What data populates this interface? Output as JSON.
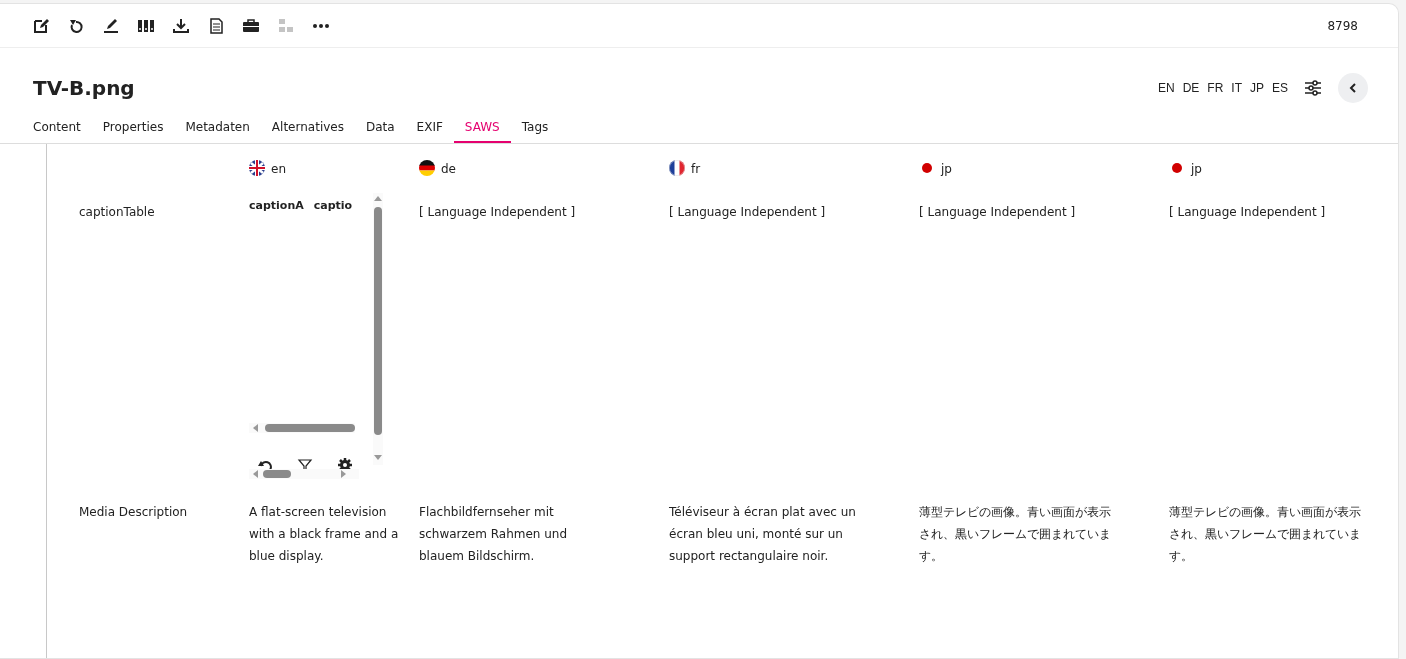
{
  "toolbar": {
    "tools": [
      {
        "kind": "edit",
        "disabled": false
      },
      {
        "kind": "undo",
        "disabled": false
      },
      {
        "kind": "sign",
        "disabled": false
      },
      {
        "kind": "binders",
        "disabled": false
      },
      {
        "kind": "download",
        "disabled": false
      },
      {
        "kind": "document",
        "disabled": false
      },
      {
        "kind": "briefcase",
        "disabled": false
      },
      {
        "kind": "hierarchy",
        "disabled": true
      },
      {
        "kind": "more",
        "disabled": false
      }
    ],
    "counter": "8798"
  },
  "header": {
    "title": "TV-B.png",
    "languages": [
      "EN",
      "DE",
      "FR",
      "IT",
      "JP",
      "ES"
    ]
  },
  "tabs": [
    {
      "label": "Content",
      "selected": false
    },
    {
      "label": "Properties",
      "selected": false
    },
    {
      "label": "Metadaten",
      "selected": false
    },
    {
      "label": "Alternatives",
      "selected": false
    },
    {
      "label": "Data",
      "selected": false
    },
    {
      "label": "EXIF",
      "selected": false
    },
    {
      "label": "SAWS",
      "selected": true
    },
    {
      "label": "Tags",
      "selected": false
    }
  ],
  "table": {
    "columns": [
      {
        "label": "en",
        "kind": "uk"
      },
      {
        "label": "de",
        "kind": "de"
      },
      {
        "label": "fr",
        "kind": "fr"
      },
      {
        "label": "jp",
        "kind": "jp"
      },
      {
        "label": "jp",
        "kind": "jp"
      }
    ],
    "rows": [
      {
        "label": "captionTable",
        "cells": [
          {
            "kind": "caption_table",
            "headers": [
              "captionA",
              "captio"
            ]
          },
          {
            "kind": "text",
            "text": "[ Language Independent ]"
          },
          {
            "kind": "text",
            "text": "[ Language Independent ]"
          },
          {
            "kind": "text",
            "text": "[ Language Independent ]"
          },
          {
            "kind": "text",
            "text": "[ Language Independent ]"
          }
        ]
      },
      {
        "label": "Media Description",
        "cells": [
          {
            "kind": "text",
            "text": "A flat-screen television with a black frame and a blue display."
          },
          {
            "kind": "text",
            "text": "Flachbildfernseher mit schwarzem Rahmen und blauem Bildschirm."
          },
          {
            "kind": "text",
            "text": "Téléviseur à écran plat avec un écran bleu uni, monté sur un support rectangulaire noir."
          },
          {
            "kind": "text",
            "text": "薄型テレビの画像。青い画面が表示され、黒いフレームで囲まれています。"
          },
          {
            "kind": "text",
            "text": "薄型テレビの画像。青い画面が表示され、黒いフレームで囲まれています。"
          }
        ]
      }
    ]
  }
}
